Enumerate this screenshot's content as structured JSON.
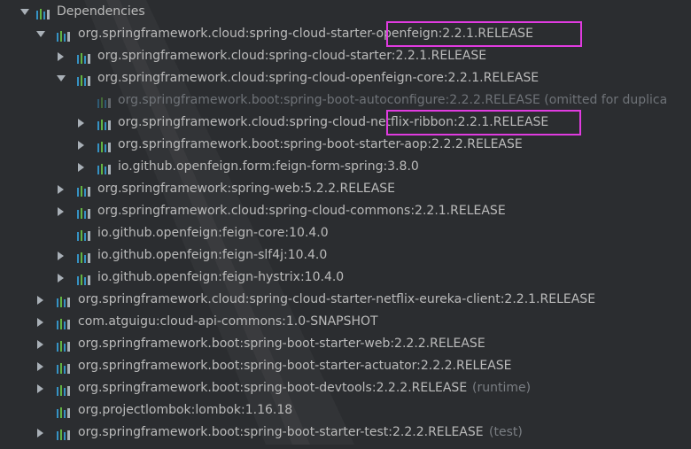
{
  "tree": {
    "root": {
      "label": "Dependencies"
    },
    "rows": [
      {
        "label": "org.springframework.cloud:spring-cloud-starter-openfeign:2.2.1.RELEASE",
        "expanded": true,
        "depth": 1
      },
      {
        "label": "org.springframework.cloud:spring-cloud-starter:2.2.1.RELEASE",
        "expanded": false,
        "depth": 2
      },
      {
        "label": "org.springframework.cloud:spring-cloud-openfeign-core:2.2.1.RELEASE",
        "expanded": true,
        "depth": 2
      },
      {
        "label": "org.springframework.boot:spring-boot-autoconfigure:2.2.2.RELEASE (omitted for duplica",
        "depth": 3,
        "omitted": true
      },
      {
        "label": "org.springframework.cloud:spring-cloud-netflix-ribbon:2.2.1.RELEASE",
        "expanded": false,
        "depth": 3
      },
      {
        "label": "org.springframework.boot:spring-boot-starter-aop:2.2.2.RELEASE",
        "expanded": false,
        "depth": 3
      },
      {
        "label": "io.github.openfeign.form:feign-form-spring:3.8.0",
        "expanded": false,
        "depth": 3
      },
      {
        "label": "org.springframework:spring-web:5.2.2.RELEASE",
        "expanded": false,
        "depth": 2
      },
      {
        "label": "org.springframework.cloud:spring-cloud-commons:2.2.1.RELEASE",
        "expanded": false,
        "depth": 2
      },
      {
        "label": "io.github.openfeign:feign-core:10.4.0",
        "depth": 2
      },
      {
        "label": "io.github.openfeign:feign-slf4j:10.4.0",
        "expanded": false,
        "depth": 2
      },
      {
        "label": "io.github.openfeign:feign-hystrix:10.4.0",
        "expanded": false,
        "depth": 2
      },
      {
        "label": "org.springframework.cloud:spring-cloud-starter-netflix-eureka-client:2.2.1.RELEASE",
        "expanded": false,
        "depth": 1
      },
      {
        "label": "com.atguigu:cloud-api-commons:1.0-SNAPSHOT",
        "expanded": false,
        "depth": 1
      },
      {
        "label": "org.springframework.boot:spring-boot-starter-web:2.2.2.RELEASE",
        "expanded": false,
        "depth": 1
      },
      {
        "label": "org.springframework.boot:spring-boot-starter-actuator:2.2.2.RELEASE",
        "expanded": false,
        "depth": 1
      },
      {
        "label": "org.springframework.boot:spring-boot-devtools:2.2.2.RELEASE",
        "expanded": false,
        "depth": 1,
        "suffix": "(runtime)"
      },
      {
        "label": "org.projectlombok:lombok:1.16.18",
        "depth": 1
      },
      {
        "label": "org.springframework.boot:spring-boot-starter-test:2.2.2.RELEASE",
        "expanded": false,
        "depth": 1,
        "suffix": "(test)"
      }
    ]
  },
  "colors": {
    "background": "#2b2d30",
    "text": "#bbbbbb",
    "dim_text": "#6f7378",
    "highlight": "#e03be0",
    "icon_blue": "#3592c4",
    "icon_green": "#62b543"
  }
}
